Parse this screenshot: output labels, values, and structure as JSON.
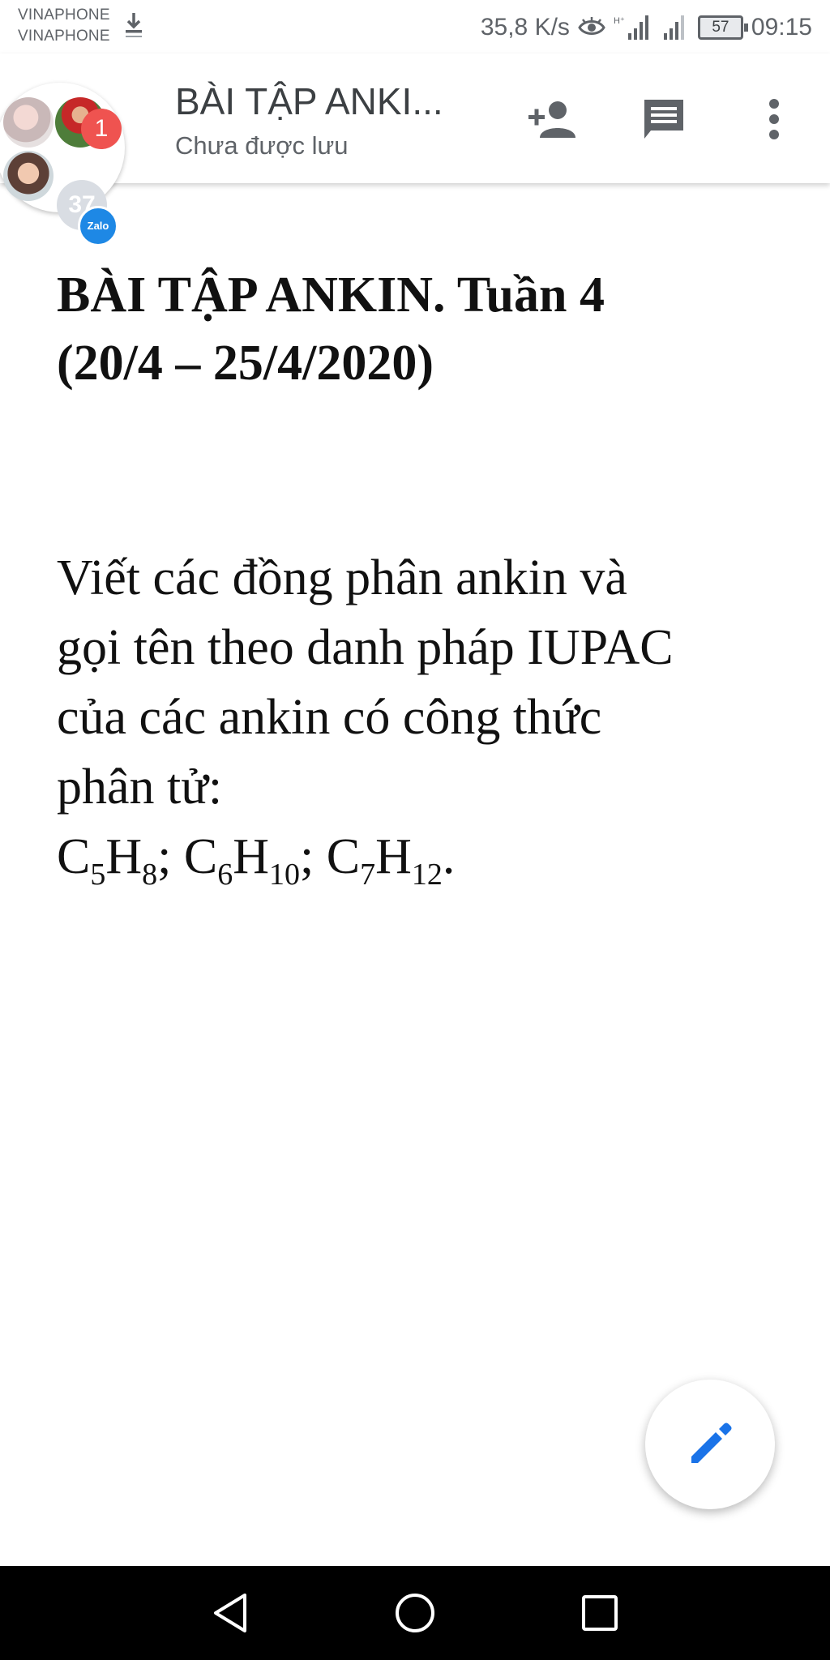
{
  "status_bar": {
    "carrier_1": "VINAPHONE",
    "carrier_2": "VINAPHONE",
    "speed": "35,8 K/s",
    "battery": "57",
    "time": "09:15",
    "icons": [
      "download-icon",
      "eye-icon",
      "signal-4g-icon",
      "signal-icon",
      "battery-icon"
    ]
  },
  "header": {
    "title": "BÀI TẬP ANKI...",
    "subtitle": "Chưa được lưu",
    "notification_badge": "1",
    "member_count": "37",
    "zalo_label": "Zalo",
    "icons": [
      "add-person-icon",
      "comment-icon",
      "more-vert-icon"
    ]
  },
  "document": {
    "heading_line1": "BÀI TẬP ANKIN. Tuần 4",
    "heading_line2": "(20/4 – 25/4/2020)",
    "paragraph_line1": "Viết các đồng phân ankin và",
    "paragraph_line2": "gọi tên theo danh pháp IUPAC",
    "paragraph_line3": "của các ankin có công thức",
    "paragraph_line4": "phân tử:",
    "formula": {
      "f1_c": "C",
      "f1_c_sub": "5",
      "f1_h": "H",
      "f1_h_sub": "8",
      "sep1": "; ",
      "f2_c": "C",
      "f2_c_sub": "6",
      "f2_h": "H",
      "f2_h_sub": "10",
      "sep2": "; ",
      "f3_c": "C",
      "f3_c_sub": "7",
      "f3_h": "H",
      "f3_h_sub": "12",
      "end": "."
    }
  },
  "fab": {
    "icon": "edit-pencil-icon"
  },
  "nav_bar": {
    "icons": [
      "back-icon",
      "home-icon",
      "recents-icon"
    ]
  },
  "colors": {
    "accent": "#1a73e8",
    "badge": "#ef5350",
    "zalo": "#1e88e5"
  }
}
